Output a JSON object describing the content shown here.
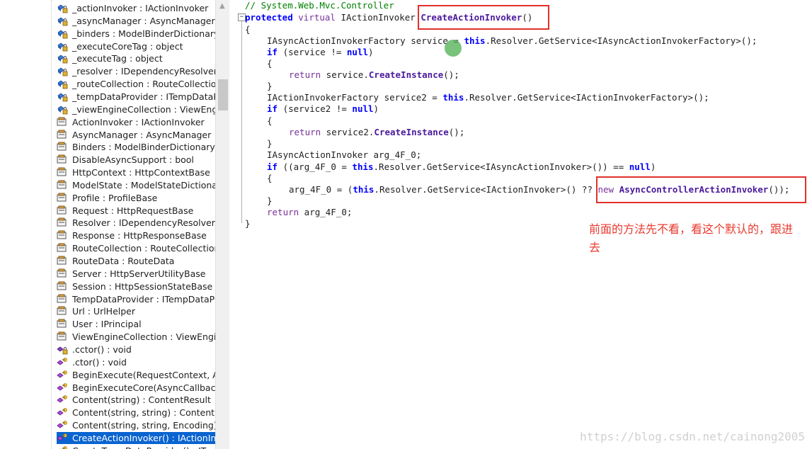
{
  "tree": {
    "items": [
      {
        "label": "_actionInvoker : IActionInvoker",
        "icon": "private-field-icon"
      },
      {
        "label": "_asyncManager : AsyncManager",
        "icon": "private-field-icon"
      },
      {
        "label": "_binders : ModelBinderDictionary",
        "icon": "private-field-icon"
      },
      {
        "label": "_executeCoreTag : object",
        "icon": "private-field-icon"
      },
      {
        "label": "_executeTag : object",
        "icon": "private-field-icon"
      },
      {
        "label": "_resolver : IDependencyResolver",
        "icon": "private-field-icon"
      },
      {
        "label": "_routeCollection : RouteCollection",
        "icon": "private-field-icon"
      },
      {
        "label": "_tempDataProvider : ITempDataProvider",
        "icon": "private-field-icon"
      },
      {
        "label": "_viewEngineCollection : ViewEngineCollection",
        "icon": "private-field-icon"
      },
      {
        "label": "ActionInvoker : IActionInvoker",
        "icon": "property-icon"
      },
      {
        "label": "AsyncManager : AsyncManager",
        "icon": "property-icon"
      },
      {
        "label": "Binders : ModelBinderDictionary",
        "icon": "property-icon"
      },
      {
        "label": "DisableAsyncSupport : bool",
        "icon": "property-icon"
      },
      {
        "label": "HttpContext : HttpContextBase",
        "icon": "property-icon"
      },
      {
        "label": "ModelState : ModelStateDictionary",
        "icon": "property-icon"
      },
      {
        "label": "Profile : ProfileBase",
        "icon": "property-icon"
      },
      {
        "label": "Request : HttpRequestBase",
        "icon": "property-icon"
      },
      {
        "label": "Resolver : IDependencyResolver",
        "icon": "property-icon"
      },
      {
        "label": "Response : HttpResponseBase",
        "icon": "property-icon"
      },
      {
        "label": "RouteCollection : RouteCollection",
        "icon": "property-icon"
      },
      {
        "label": "RouteData : RouteData",
        "icon": "property-icon"
      },
      {
        "label": "Server : HttpServerUtilityBase",
        "icon": "property-icon"
      },
      {
        "label": "Session : HttpSessionStateBase",
        "icon": "property-icon"
      },
      {
        "label": "TempDataProvider : ITempDataProvider",
        "icon": "property-icon"
      },
      {
        "label": "Url : UrlHelper",
        "icon": "property-icon"
      },
      {
        "label": "User : IPrincipal",
        "icon": "property-icon"
      },
      {
        "label": "ViewEngineCollection : ViewEngineCollection",
        "icon": "property-icon"
      },
      {
        "label": ".cctor() : void",
        "icon": "private-method-icon"
      },
      {
        "label": ".ctor() : void",
        "icon": "protected-method-icon"
      },
      {
        "label": "BeginExecute(RequestContext, AsyncCallback, object)",
        "icon": "protected-method-icon"
      },
      {
        "label": "BeginExecuteCore(AsyncCallback, object)",
        "icon": "protected-method-icon"
      },
      {
        "label": "Content(string) : ContentResult",
        "icon": "protected-method-icon"
      },
      {
        "label": "Content(string, string) : ContentResult",
        "icon": "protected-method-icon"
      },
      {
        "label": "Content(string, string, Encoding) : ContentResult",
        "icon": "protected-method-icon"
      },
      {
        "label": "CreateActionInvoker() : IActionInvoker",
        "icon": "protected-method-icon",
        "selected": true
      },
      {
        "label": "CreateTempDataProvider() : ITempDataProvider",
        "icon": "protected-method-icon"
      }
    ]
  },
  "code": {
    "comment": "// System.Web.Mvc.Controller",
    "lines": [
      {
        "indent": 0,
        "parts": [
          {
            "t": "protected",
            "c": "kw"
          },
          {
            "t": " "
          },
          {
            "t": "virtual",
            "c": "kw2"
          },
          {
            "t": " IActionInvoker "
          },
          {
            "t": "CreateActionInvoker",
            "c": "mth"
          },
          {
            "t": "()"
          }
        ]
      },
      {
        "indent": 0,
        "parts": [
          {
            "t": "{"
          }
        ]
      },
      {
        "indent": 1,
        "parts": [
          {
            "t": "IAsyncActionInvokerFactory service = "
          },
          {
            "t": "this",
            "c": "kw"
          },
          {
            "t": ".Resolver.GetService<IAsyncActionInvokerFactory>();"
          }
        ]
      },
      {
        "indent": 1,
        "parts": [
          {
            "t": "if",
            "c": "kw"
          },
          {
            "t": " (service != "
          },
          {
            "t": "null",
            "c": "kw"
          },
          {
            "t": ")"
          }
        ]
      },
      {
        "indent": 1,
        "parts": [
          {
            "t": "{"
          }
        ]
      },
      {
        "indent": 2,
        "parts": [
          {
            "t": "return",
            "c": "kw2"
          },
          {
            "t": " service."
          },
          {
            "t": "CreateInstance",
            "c": "mth"
          },
          {
            "t": "();"
          }
        ]
      },
      {
        "indent": 1,
        "parts": [
          {
            "t": "}"
          }
        ]
      },
      {
        "indent": 1,
        "parts": [
          {
            "t": "IActionInvokerFactory service2 = "
          },
          {
            "t": "this",
            "c": "kw"
          },
          {
            "t": ".Resolver.GetService<IActionInvokerFactory>();"
          }
        ]
      },
      {
        "indent": 1,
        "parts": [
          {
            "t": "if",
            "c": "kw"
          },
          {
            "t": " (service2 != "
          },
          {
            "t": "null",
            "c": "kw"
          },
          {
            "t": ")"
          }
        ]
      },
      {
        "indent": 1,
        "parts": [
          {
            "t": "{"
          }
        ]
      },
      {
        "indent": 2,
        "parts": [
          {
            "t": "return",
            "c": "kw2"
          },
          {
            "t": " service2."
          },
          {
            "t": "CreateInstance",
            "c": "mth"
          },
          {
            "t": "();"
          }
        ]
      },
      {
        "indent": 1,
        "parts": [
          {
            "t": "}"
          }
        ]
      },
      {
        "indent": 1,
        "parts": [
          {
            "t": "IAsyncActionInvoker arg_4F_0;"
          }
        ]
      },
      {
        "indent": 1,
        "parts": [
          {
            "t": "if",
            "c": "kw"
          },
          {
            "t": " ((arg_4F_0 = "
          },
          {
            "t": "this",
            "c": "kw"
          },
          {
            "t": ".Resolver.GetService<IAsyncActionInvoker>()) == "
          },
          {
            "t": "null",
            "c": "kw"
          },
          {
            "t": ")"
          }
        ]
      },
      {
        "indent": 1,
        "parts": [
          {
            "t": "{"
          }
        ]
      },
      {
        "indent": 2,
        "parts": [
          {
            "t": "arg_4F_0 = ("
          },
          {
            "t": "this",
            "c": "kw"
          },
          {
            "t": ".Resolver.GetService<IActionInvoker>() ?? "
          },
          {
            "t": "new",
            "c": "kw2"
          },
          {
            "t": " "
          },
          {
            "t": "AsyncControllerActionInvoker",
            "c": "mth"
          },
          {
            "t": "());"
          }
        ]
      },
      {
        "indent": 1,
        "parts": [
          {
            "t": "}"
          }
        ]
      },
      {
        "indent": 1,
        "parts": [
          {
            "t": "return",
            "c": "kw2"
          },
          {
            "t": " arg_4F_0;"
          }
        ]
      },
      {
        "indent": 0,
        "parts": [
          {
            "t": "}"
          }
        ]
      }
    ]
  },
  "annotation": "前面的方法先不看，看这个默认的，跟进去",
  "watermark": "https://blog.csdn.net/cainong2005",
  "colors": {
    "highlight_box": "#e0302a",
    "annotation": "#e83a2e",
    "selection": "#0a64d0"
  }
}
